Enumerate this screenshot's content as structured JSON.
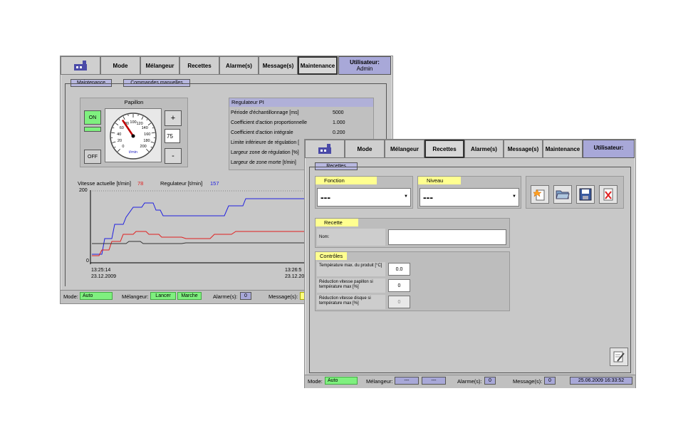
{
  "win1": {
    "nav": [
      "Mode",
      "Mélangeur",
      "Recettes",
      "Alarme(s)",
      "Message(s)",
      "Maintenance"
    ],
    "user_title": "Utilisateur:",
    "user_name": "Admin",
    "tabs": [
      "Maintenance",
      "Commandes manuelles"
    ],
    "papillon": {
      "title": "Papillon",
      "on": "ON",
      "off": "OFF",
      "plus": "+",
      "minus": "-",
      "value": "75",
      "gauge_ticks": [
        "0",
        "20",
        "40",
        "60",
        "80",
        "100",
        "120",
        "140",
        "160",
        "180",
        "200"
      ],
      "gauge_unit": "t/min",
      "gauge_value": 75
    },
    "pi": {
      "title": "Regulateur PI",
      "rows": [
        {
          "label": "Période d'échantillonnage [ms]",
          "value": "5000"
        },
        {
          "label": "Coefficient d'action proportionnelle",
          "value": "1.000"
        },
        {
          "label": "Coefficient d'action intégrale",
          "value": "0.200"
        },
        {
          "label": "Limite inférieure de régulation [",
          "value": ""
        },
        {
          "label": "Largeur zone de régulation [%]",
          "value": ""
        },
        {
          "label": "Largeur de zone morte [t/min]",
          "value": ""
        }
      ]
    },
    "trend": {
      "speed_label": "Vitesse actuelle [t/min]",
      "speed_value": "78",
      "reg_label": "Regulateur [t/min]",
      "reg_value": "157",
      "ymax": "200",
      "ymin": "0",
      "t_start": "13:25:14",
      "d_start": "23.12.2009",
      "t_end": "13:26:5",
      "d_end": "23.12.20"
    },
    "status": {
      "mode_label": "Mode:",
      "mode_value": "Auto",
      "mixer_label": "Mélangeur:",
      "lancer": "Lancer",
      "marche": "Marche",
      "alarm_label": "Alarme(s):",
      "alarm_value": "0",
      "msg_label": "Message(s):"
    }
  },
  "win2": {
    "nav": [
      "Mode",
      "Mélangeur",
      "Recettes",
      "Alarme(s)",
      "Message(s)",
      "Maintenance"
    ],
    "user_title": "Utilisateur:",
    "tab": "Recettes",
    "fonction_label": "Fonction",
    "fonction_value": "---",
    "niveau_label": "Niveau",
    "niveau_value": "---",
    "recette_label": "Recette",
    "nom_label": "Nom:",
    "nom_value": "",
    "controles_label": "Contrôles",
    "controls": [
      {
        "label": "Température max. du produit [°C]",
        "value": "0.0"
      },
      {
        "label": "Réduction vitesse papillon si température max [%]",
        "value": "0"
      },
      {
        "label": "Réduction vitesse disque si température max [%]",
        "value": "0"
      }
    ],
    "status": {
      "mode_label": "Mode:",
      "mode_value": "Auto",
      "mixer_label": "Mélangeur:",
      "mixer_v1": "---",
      "mixer_v2": "---",
      "alarm_label": "Alarme(s):",
      "alarm_value": "0",
      "msg_label": "Message(s):",
      "msg_value": "0",
      "datetime": "25.06.2009 16:33:52"
    }
  }
}
